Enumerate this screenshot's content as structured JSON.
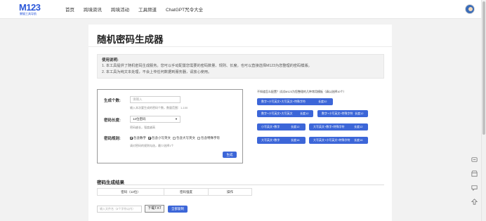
{
  "logo": {
    "main": "M123",
    "sub": "懒猫工具导航"
  },
  "nav": [
    "首页",
    "跨境资讯",
    "跨境活动",
    "工具频道",
    "ChatGPT咒令大全"
  ],
  "page": {
    "title": "随机密码生成器",
    "usage": {
      "title": "使用说明:",
      "lines": [
        "1. 本工具提供了随机密码生成服务。您可以手动配置您需要的密码数量、规则、长度。也可以直接选择M123为您整理的密码模版。",
        "2. 本工具为纯文本处理，不会上传任何数据到服务器，请放心使用。"
      ]
    }
  },
  "form": {
    "count_label": "生成个数:",
    "count_placeholder": "请输入",
    "count_hint": "输入本次要生成的密码个数，数量范围：1-100",
    "length_label": "密码长度:",
    "length_value": "12位密码",
    "length_hint": "密码越长，强度越高",
    "rule_label": "密码规则:",
    "rules": [
      {
        "label": "包含数字",
        "checked": true
      },
      {
        "label": "包含小写英文",
        "checked": true
      },
      {
        "label": "包含大写英文",
        "checked": false
      },
      {
        "label": "包含特殊字符",
        "checked": false
      }
    ],
    "rule_hint": "请对密码的规则勾选，最少选择1个",
    "generate": "生成"
  },
  "presets": {
    "hint": "不知道怎么配置？试试M123为您整理的几种常用模板（请以选择10个）",
    "items": [
      {
        "label": "数字+小写英文+大写英文+特殊字符",
        "len": "长度32"
      },
      {
        "label": "数字+小写英文+大写英文",
        "len": "长度12"
      },
      {
        "label": "数字+小写英文+特殊字符",
        "len": "长度12"
      },
      {
        "label": "小写英文+数字",
        "len": "长度12"
      },
      {
        "label": "大写英文+数字+特殊字符",
        "len": "长度12"
      },
      {
        "label": "大写英文+数字",
        "len": "长度16"
      },
      {
        "label": "大写英文+小写英文+特殊字符",
        "len": "长度16"
      }
    ]
  },
  "results": {
    "title": "密码生成结果",
    "columns": [
      "密码（12位）",
      "密码强度",
      "操作"
    ],
    "filename_placeholder": "输入文件名（8个字符以内）",
    "download": "下载TXT",
    "copy_all": "全部复制"
  },
  "colors": {
    "accent": "#3c66d8",
    "logo": "#2b57d9"
  }
}
